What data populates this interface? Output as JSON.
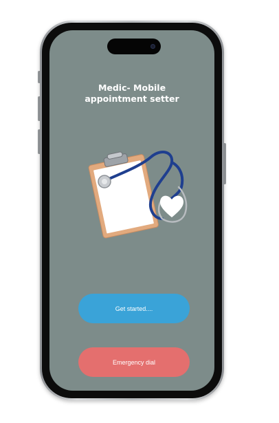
{
  "app": {
    "title_line1": "Medic- Mobile",
    "title_line2": "appointment setter"
  },
  "illustration": {
    "icon": "clipboard-stethoscope-icon",
    "colors": {
      "clipboard": "#e2aa7e",
      "paper": "#ffffff",
      "tube": "#1f3f8f",
      "heart": "#ffffff"
    }
  },
  "buttons": {
    "get_started_label": "Get started....",
    "emergency_label": "Emergency dial"
  },
  "colors": {
    "screen_background": "#7d8c8a",
    "primary_button": "#3aa3d8",
    "emergency_button": "#e46f6e",
    "text": "#ffffff"
  }
}
